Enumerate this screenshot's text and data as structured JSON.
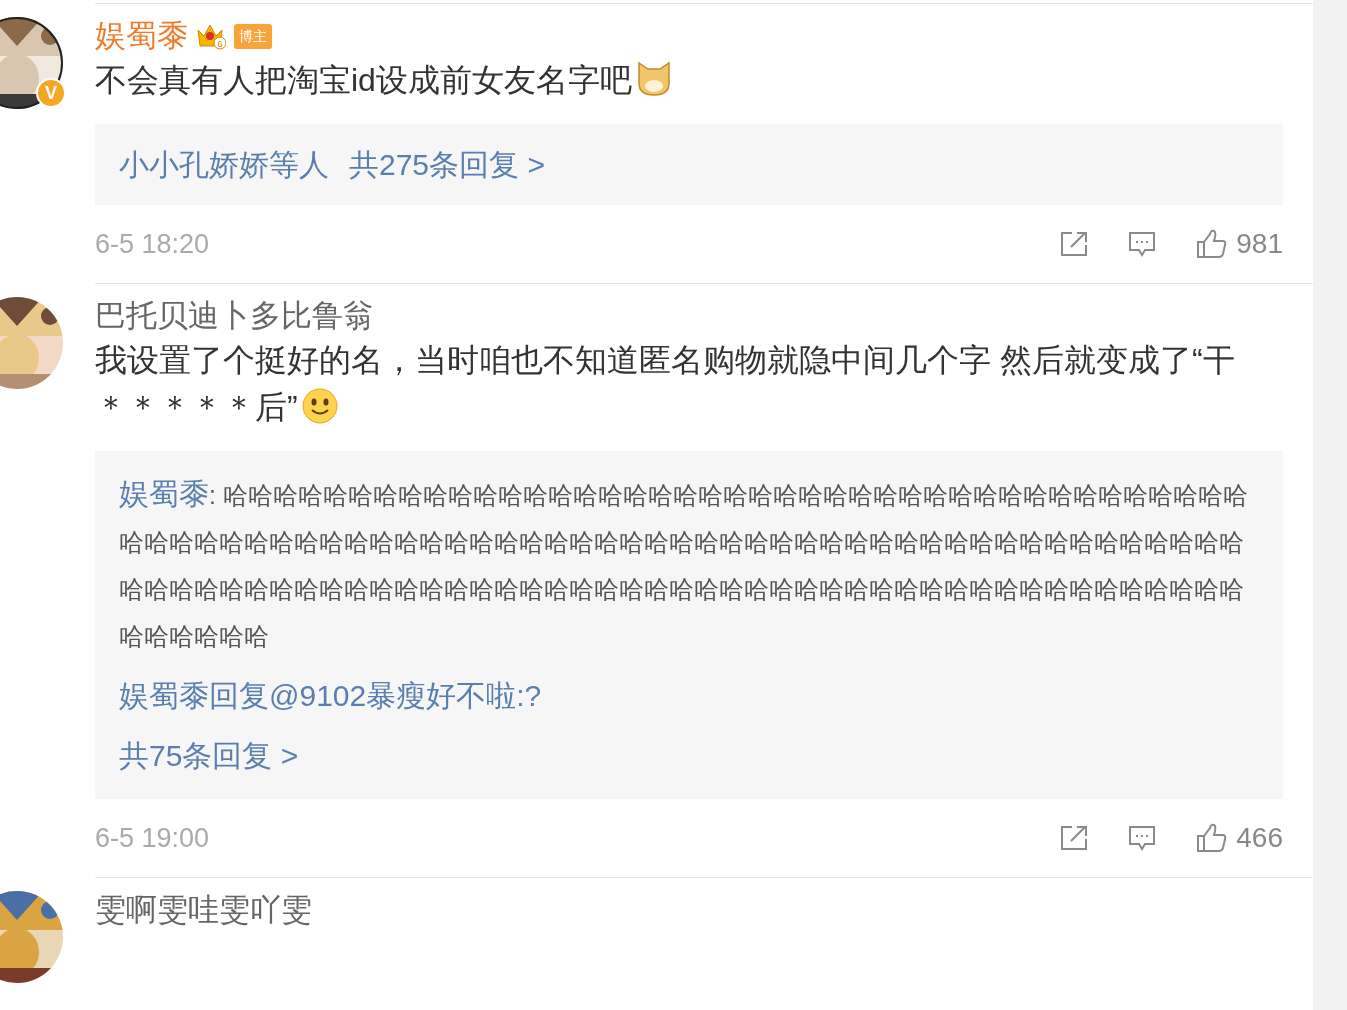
{
  "comments": [
    {
      "username": "娱蜀黍",
      "is_author": true,
      "verified_badge": "V",
      "vip_level": "6",
      "badge": "博主",
      "text": "不会真有人把淘宝id设成前女友名字吧",
      "emoji": {
        "kind": "dog"
      },
      "replies": {
        "kind": "summary",
        "users": "小小孔娇娇等人",
        "link": "共275条回复 >"
      },
      "time": "6-5 18:20",
      "likes": "981"
    },
    {
      "username": "巴托贝迪卜多比鲁翁",
      "is_author": false,
      "text": "我设置了个挺好的名，当时咱也不知道匿名购物就隐中间几个字 然后就变成了“干＊＊＊＊＊后”",
      "emoji": {
        "kind": "smile"
      },
      "replies": {
        "kind": "list",
        "items": [
          {
            "author": "娱蜀黍",
            "text": ": 哈哈哈哈哈哈哈哈哈哈哈哈哈哈哈哈哈哈哈哈哈哈哈哈哈哈哈哈哈哈哈哈哈哈哈哈哈哈哈哈哈哈哈哈哈哈哈哈哈哈哈哈哈哈哈哈哈哈哈哈哈哈哈哈哈哈哈哈哈哈哈哈哈哈哈哈哈哈哈哈哈哈哈哈哈哈哈哈哈哈哈哈哈哈哈哈哈哈哈哈哈哈哈哈哈哈哈哈哈哈哈哈哈哈哈哈哈哈哈哈哈哈哈哈哈哈哈哈哈哈哈哈哈哈哈哈哈"
          },
          {
            "author": "娱蜀黍回复@9102暴瘦好不啦",
            "text": ":?"
          }
        ],
        "link": "共75条回复 >"
      },
      "time": "6-5 19:00",
      "likes": "466"
    },
    {
      "username": "雯啊雯哇雯吖雯",
      "is_author": false
    }
  ]
}
